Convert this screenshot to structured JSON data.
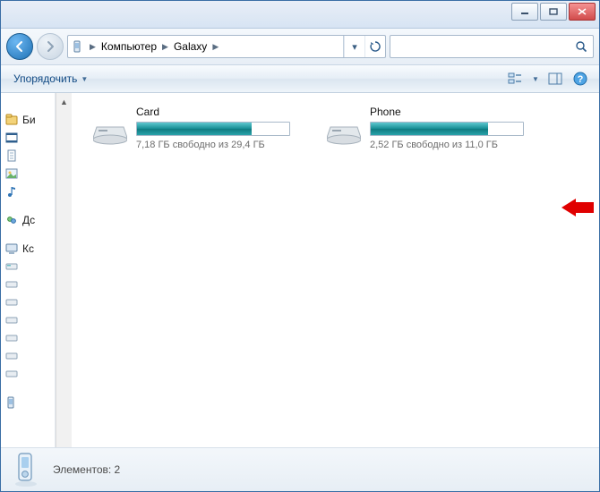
{
  "breadcrumb": {
    "seg1": "Компьютер",
    "seg2": "Galaxy"
  },
  "toolbar": {
    "organize": "Упорядочить"
  },
  "sidebar": {
    "lib_label": "Би",
    "home_label": "Дс",
    "comp_label": "Кс"
  },
  "drives": [
    {
      "name": "Card",
      "sub": "7,18 ГБ свободно из 29,4 ГБ",
      "fill_pct": 75
    },
    {
      "name": "Phone",
      "sub": "2,52 ГБ свободно из 11,0 ГБ",
      "fill_pct": 77
    }
  ],
  "status": {
    "text": "Элементов: 2"
  }
}
